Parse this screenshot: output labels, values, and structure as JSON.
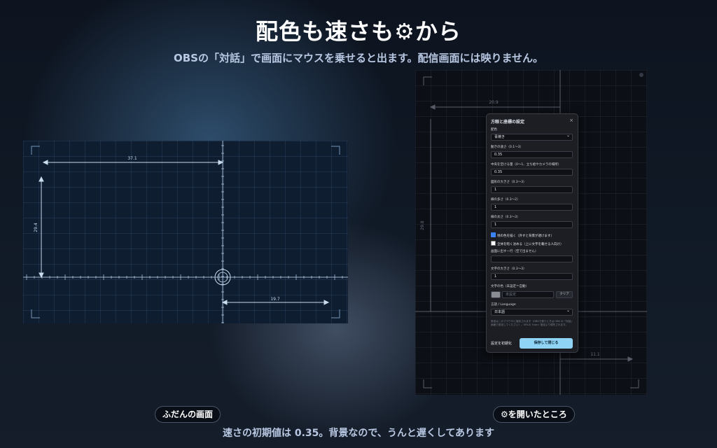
{
  "header": {
    "title": "配色も速さも⚙から",
    "subtitle": "OBSの「対話」で画面にマウスを乗せると出ます。配信画面には映りません。"
  },
  "footer": {
    "note": "速さの初期値は 0.35。背景なので、うんと遅くしてあります"
  },
  "captions": {
    "left": "ふだんの画面",
    "right": "⚙を開いたところ"
  },
  "left_screen": {
    "measure_top": "37.1",
    "measure_left": "29.4",
    "measure_bottom": "19.7"
  },
  "right_screen": {
    "measure_top": "20.9",
    "measure_left": "29.8",
    "measure_bottom": "11.1"
  },
  "settings": {
    "title": "方眼と座標の設定",
    "close": "×",
    "color_label": "配色",
    "color_value": "青焼き",
    "speed_label": "動きの速さ（0.1〜3）",
    "speed_value": "0.35",
    "center_label": "中央を空ける量（0〜1、立ち絵やカメラの場所）",
    "center_value": "0.35",
    "shape_size_label": "図形の大きさ（0.3〜3）",
    "shape_size_value": "1",
    "line_count_label": "線の多さ（0.3〜2）",
    "line_count_value": "1",
    "line_width_label": "線の太さ（0.3〜3）",
    "line_width_value": "1",
    "ground_label": "地の色を描く（外すと背景が透けます）",
    "ground_checked": true,
    "dim_label": "全体を暗く沈める（上に文字を載せる人向け）",
    "dim_checked": false,
    "caption_label": "画面に出す一行（空で出ません）",
    "caption_value": "",
    "text_size_label": "文字の大きさ（0.3〜3）",
    "text_size_value": "1",
    "text_color_label": "文字の色（未設定＝自動）",
    "text_color_placeholder": "未設定",
    "clear_label": "クリア",
    "language_label": "言語 / Language",
    "language_value": "日本語",
    "storage_note": "設定はこのブラウザに保存されます（OBSで使うときは OBS の「対話」画面で設定してください）。URLの ?use= 指定より優先されます。",
    "reset_label": "設定を初期化",
    "save_label": "保存して閉じる",
    "swatch_color": "#8a8d93",
    "accent_color": "#8fd3f5"
  }
}
